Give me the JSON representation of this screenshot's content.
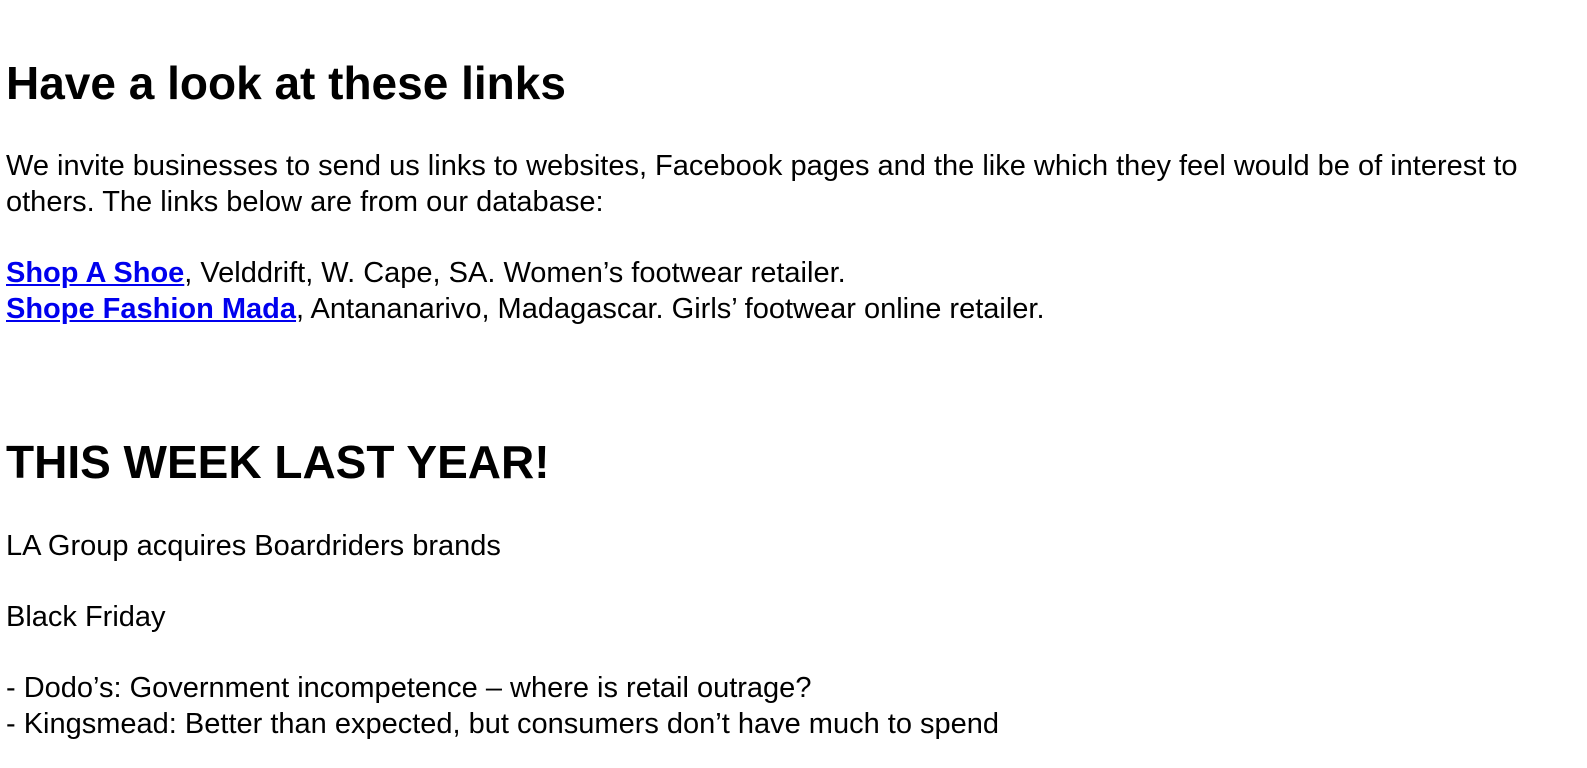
{
  "links_section": {
    "heading": "Have a look at these links",
    "intro": "We invite businesses to send us links to websites, Facebook pages and the like which they feel would be of interest to others. The links below are from our database:",
    "items": [
      {
        "name": "Shop A Shoe",
        "desc": ", Velddrift, W. Cape, SA. Women’s footwear retailer."
      },
      {
        "name": "Shope Fashion Mada",
        "desc": ", Antananarivo, Madagascar. Girls’ footwear online retailer."
      }
    ],
    "link_color": "#0000ee"
  },
  "last_year_section": {
    "heading": "THIS WEEK LAST YEAR!",
    "items": [
      "LA Group acquires Boardriders brands",
      "Black Friday"
    ],
    "sub_items": [
      "- Dodo’s: Government incompetence – where is retail outrage?",
      "- Kingsmead: Better than expected, but consumers don’t have much to spend"
    ]
  }
}
